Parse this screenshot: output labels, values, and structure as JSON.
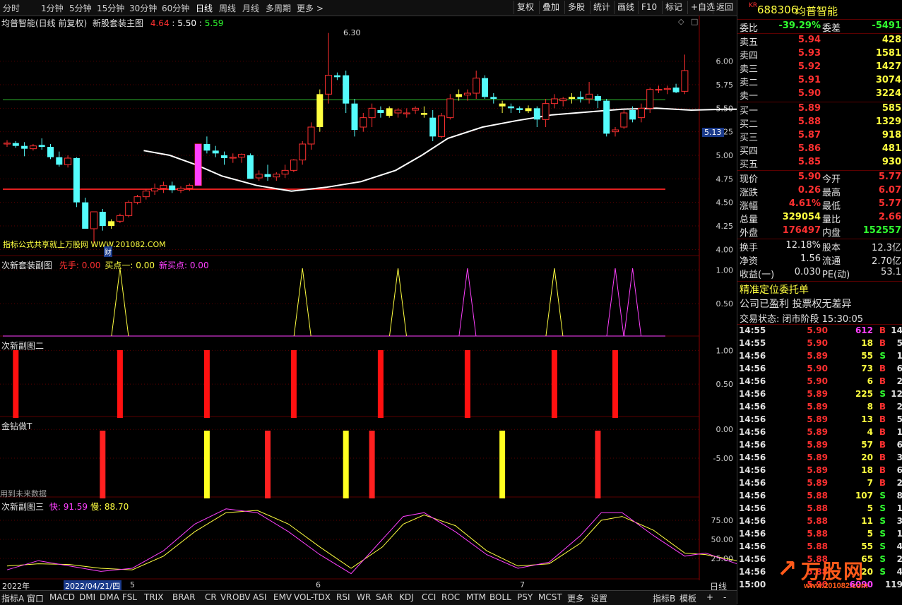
{
  "toolbar": {
    "periods": [
      "分时",
      "1分钟",
      "5分钟",
      "15分钟",
      "30分钟",
      "60分钟",
      "日线",
      "周线",
      "月线",
      "多周期",
      "更多 >"
    ],
    "active_period": "日线",
    "right_buttons": [
      "复权",
      "叠加",
      "多股",
      "统计",
      "画线",
      "F10",
      "标记",
      "+自选",
      "返回"
    ]
  },
  "main_panel": {
    "stock_label": "均普智能(日线 前复权)",
    "indicator_name": "新股套装主图",
    "values": [
      "4.64",
      "5.50",
      "5.59"
    ],
    "annotation": "指标公式共享就上万股网 WWW.201082.COM",
    "high_label": "6.30",
    "event_tag": "财",
    "current_price_tag": "5.13",
    "y_ticks": [
      "6.00",
      "5.75",
      "5.50",
      "5.25",
      "5.00",
      "4.75",
      "4.50",
      "4.25",
      "4.00"
    ]
  },
  "sub1": {
    "name": "次新套装副图",
    "labels": [
      {
        "text": "先手: 0.00",
        "color": "#ff3030"
      },
      {
        "text": "买点一: 0.00",
        "color": "#ffff40"
      },
      {
        "text": "新买点: 0.00",
        "color": "#ff40ff"
      }
    ],
    "y_ticks": [
      "1.00",
      "0.50"
    ]
  },
  "sub2": {
    "name": "次新副图二",
    "y_ticks": [
      "1.00",
      "0.50"
    ]
  },
  "sub3": {
    "name": "金钻做T",
    "note": "用到未来数据",
    "y_ticks": [
      "0.00",
      "-5.00"
    ]
  },
  "sub4": {
    "name": "次新副图三",
    "labels": [
      {
        "text": "快: 91.59",
        "color": "#ff40ff"
      },
      {
        "text": "慢: 88.70",
        "color": "#ffff40"
      }
    ],
    "y_ticks": [
      "75.00",
      "50.00",
      "25.00"
    ]
  },
  "date_axis": {
    "year": "2022年",
    "cursor_date": "2022/04/21/四",
    "months": [
      "5",
      "6",
      "7"
    ],
    "period": "日线"
  },
  "bottom_tabs": [
    "指标A",
    "窗口",
    "MACD",
    "DMI",
    "DMA",
    "FSL",
    "TRIX",
    "BRAR",
    "CR",
    "VR",
    "OBV",
    "ASI",
    "EMV",
    "VOL-TDX",
    "RSI",
    "WR",
    "SAR",
    "KDJ",
    "CCI",
    "ROC",
    "MTM",
    "BOLL",
    "PSY",
    "MCST",
    "更多",
    "设置"
  ],
  "bottom_right": [
    "指标B",
    "模板",
    "+",
    "-"
  ],
  "quote": {
    "badge": "KR",
    "code": "688306",
    "name": "均普智能",
    "weibi_label": "委比",
    "weibi": "-39.29%",
    "weicha_label": "委差",
    "weicha": "-5491",
    "asks": [
      {
        "label": "卖五",
        "price": "5.94",
        "vol": "428"
      },
      {
        "label": "卖四",
        "price": "5.93",
        "vol": "1581"
      },
      {
        "label": "卖三",
        "price": "5.92",
        "vol": "1427"
      },
      {
        "label": "卖二",
        "price": "5.91",
        "vol": "3074"
      },
      {
        "label": "卖一",
        "price": "5.90",
        "vol": "3224"
      }
    ],
    "bids": [
      {
        "label": "买一",
        "price": "5.89",
        "vol": "585"
      },
      {
        "label": "买二",
        "price": "5.88",
        "vol": "1329"
      },
      {
        "label": "买三",
        "price": "5.87",
        "vol": "918"
      },
      {
        "label": "买四",
        "price": "5.86",
        "vol": "481"
      },
      {
        "label": "买五",
        "price": "5.85",
        "vol": "930"
      }
    ],
    "stats": [
      {
        "l1": "现价",
        "v1": "5.90",
        "c1": "#ff3030",
        "l2": "今开",
        "v2": "5.77",
        "c2": "#ff3030"
      },
      {
        "l1": "涨跌",
        "v1": "0.26",
        "c1": "#ff3030",
        "l2": "最高",
        "v2": "6.07",
        "c2": "#ff3030"
      },
      {
        "l1": "涨幅",
        "v1": "4.61%",
        "c1": "#ff3030",
        "l2": "最低",
        "v2": "5.77",
        "c2": "#ff3030"
      },
      {
        "l1": "总量",
        "v1": "329054",
        "c1": "#ffff40",
        "l2": "量比",
        "v2": "2.66",
        "c2": "#ff3030"
      },
      {
        "l1": "外盘",
        "v1": "176497",
        "c1": "#ff3030",
        "l2": "内盘",
        "v2": "152557",
        "c2": "#30ff30"
      }
    ],
    "stats2": [
      {
        "l1": "换手",
        "v1": "12.18%",
        "l2": "股本",
        "v2": "12.3亿"
      },
      {
        "l1": "净资",
        "v1": "1.56",
        "l2": "流通",
        "v2": "2.70亿"
      },
      {
        "l1": "收益(一)",
        "v1": "0.030",
        "l2": "PE(动)",
        "v2": "53.1"
      }
    ],
    "link1": "精准定位委托单",
    "line2": "公司已盈利 投票权无差异",
    "status": "交易状态: 闭市阶段 15:30:05",
    "ticks": [
      {
        "t": "14:55",
        "p": "5.90",
        "v": "612",
        "s": "B",
        "n": "14",
        "vc": "#ff40ff"
      },
      {
        "t": "14:55",
        "p": "5.90",
        "v": "18",
        "s": "B",
        "n": "5",
        "vc": "#ffff40"
      },
      {
        "t": "14:56",
        "p": "5.89",
        "v": "55",
        "s": "S",
        "n": "1",
        "vc": "#ffff40"
      },
      {
        "t": "14:56",
        "p": "5.90",
        "v": "73",
        "s": "B",
        "n": "6",
        "vc": "#ffff40"
      },
      {
        "t": "14:56",
        "p": "5.90",
        "v": "6",
        "s": "B",
        "n": "2",
        "vc": "#ffff40"
      },
      {
        "t": "14:56",
        "p": "5.89",
        "v": "225",
        "s": "S",
        "n": "12",
        "vc": "#ffff40"
      },
      {
        "t": "14:56",
        "p": "5.89",
        "v": "8",
        "s": "B",
        "n": "2",
        "vc": "#ffff40"
      },
      {
        "t": "14:56",
        "p": "5.89",
        "v": "13",
        "s": "B",
        "n": "5",
        "vc": "#ffff40"
      },
      {
        "t": "14:56",
        "p": "5.89",
        "v": "4",
        "s": "B",
        "n": "1",
        "vc": "#ffff40"
      },
      {
        "t": "14:56",
        "p": "5.89",
        "v": "57",
        "s": "B",
        "n": "6",
        "vc": "#ffff40"
      },
      {
        "t": "14:56",
        "p": "5.89",
        "v": "20",
        "s": "B",
        "n": "3",
        "vc": "#ffff40"
      },
      {
        "t": "14:56",
        "p": "5.89",
        "v": "18",
        "s": "B",
        "n": "6",
        "vc": "#ffff40"
      },
      {
        "t": "14:56",
        "p": "5.89",
        "v": "7",
        "s": "B",
        "n": "2",
        "vc": "#ffff40"
      },
      {
        "t": "14:56",
        "p": "5.88",
        "v": "107",
        "s": "S",
        "n": "8",
        "vc": "#ffff40"
      },
      {
        "t": "14:56",
        "p": "5.88",
        "v": "5",
        "s": "S",
        "n": "1",
        "vc": "#ffff40"
      },
      {
        "t": "14:56",
        "p": "5.88",
        "v": "11",
        "s": "S",
        "n": "3",
        "vc": "#ffff40"
      },
      {
        "t": "14:56",
        "p": "5.88",
        "v": "5",
        "s": "S",
        "n": "1",
        "vc": "#ffff40"
      },
      {
        "t": "14:56",
        "p": "5.88",
        "v": "55",
        "s": "S",
        "n": "4",
        "vc": "#ffff40"
      },
      {
        "t": "14:56",
        "p": "5.88",
        "v": "65",
        "s": "S",
        "n": "2",
        "vc": "#ffff40"
      },
      {
        "t": "14:56",
        "p": "5.88",
        "v": "20",
        "s": "S",
        "n": "4",
        "vc": "#ffff40"
      },
      {
        "t": "15:00",
        "p": "5.90",
        "v": "6090",
        "s": "",
        "n": "119",
        "vc": "#ff40ff"
      }
    ]
  },
  "watermark": {
    "text": "万股网",
    "url": "www.201082.com"
  },
  "colors": {
    "up": "#ff3030",
    "down": "#54fcfc",
    "yellow": "#ffff40",
    "magenta": "#ff40ff",
    "green": "#30ff30",
    "ma": "#ffffff"
  },
  "chart_data": {
    "type": "candlestick",
    "ylim": [
      3.95,
      6.35
    ],
    "candles": [
      [
        5.12,
        5.16,
        5.09,
        5.13
      ],
      [
        5.13,
        5.15,
        5.08,
        5.1
      ],
      [
        5.1,
        5.14,
        4.99,
        5.07
      ],
      [
        5.07,
        5.12,
        5.05,
        5.1
      ],
      [
        5.11,
        5.18,
        5.06,
        5.09
      ],
      [
        5.09,
        5.12,
        4.96,
        4.98
      ],
      [
        4.98,
        5.04,
        4.88,
        4.9
      ],
      [
        4.9,
        5.0,
        4.87,
        4.97
      ],
      [
        4.97,
        4.98,
        4.45,
        4.5
      ],
      [
        4.5,
        4.55,
        4.22,
        4.22
      ],
      [
        4.22,
        4.4,
        4.05,
        4.4
      ],
      [
        4.4,
        4.43,
        4.2,
        4.25
      ],
      [
        4.25,
        4.32,
        4.22,
        4.3
      ],
      [
        4.3,
        4.38,
        4.28,
        4.36
      ],
      [
        4.36,
        4.52,
        4.34,
        4.5
      ],
      [
        4.5,
        4.58,
        4.48,
        4.56
      ],
      [
        4.56,
        4.64,
        4.53,
        4.62
      ],
      [
        4.62,
        4.7,
        4.58,
        4.65
      ],
      [
        4.65,
        4.72,
        4.6,
        4.68
      ],
      [
        4.68,
        4.72,
        4.6,
        4.63
      ],
      [
        4.63,
        4.67,
        4.6,
        4.65
      ],
      [
        4.65,
        4.7,
        4.62,
        4.68
      ],
      [
        4.68,
        5.06,
        4.68,
        5.12
      ],
      [
        5.12,
        5.2,
        5.02,
        5.05
      ],
      [
        5.05,
        5.1,
        4.98,
        5.02
      ],
      [
        5.0,
        5.04,
        4.9,
        4.97
      ],
      [
        4.97,
        5.02,
        4.92,
        4.98
      ],
      [
        4.98,
        5.02,
        4.92,
        5.01
      ],
      [
        5.0,
        5.02,
        4.75,
        4.75
      ],
      [
        4.76,
        4.84,
        4.73,
        4.8
      ],
      [
        4.8,
        4.9,
        4.73,
        4.77
      ],
      [
        4.77,
        4.82,
        4.73,
        4.8
      ],
      [
        4.8,
        4.9,
        4.76,
        4.84
      ],
      [
        4.84,
        4.96,
        4.82,
        4.95
      ],
      [
        4.95,
        5.15,
        4.9,
        5.12
      ],
      [
        5.12,
        5.35,
        5.06,
        5.3
      ],
      [
        5.3,
        5.7,
        5.25,
        5.65
      ],
      [
        5.65,
        6.3,
        5.55,
        5.85
      ],
      [
        5.85,
        5.88,
        5.8,
        5.83
      ],
      [
        5.85,
        5.9,
        5.45,
        5.55
      ],
      [
        5.55,
        5.6,
        5.2,
        5.27
      ],
      [
        5.3,
        5.45,
        5.25,
        5.4
      ],
      [
        5.4,
        5.55,
        5.3,
        5.5
      ],
      [
        5.48,
        5.52,
        5.4,
        5.45
      ],
      [
        5.5,
        5.52,
        5.4,
        5.42
      ],
      [
        5.45,
        5.5,
        5.4,
        5.48
      ],
      [
        5.44,
        5.5,
        5.4,
        5.45
      ],
      [
        5.48,
        5.52,
        5.44,
        5.5
      ],
      [
        5.45,
        5.52,
        5.4,
        5.43
      ],
      [
        5.4,
        5.48,
        5.15,
        5.2
      ],
      [
        5.2,
        5.45,
        5.18,
        5.42
      ],
      [
        5.4,
        5.65,
        5.38,
        5.6
      ],
      [
        5.62,
        5.7,
        5.58,
        5.65
      ],
      [
        5.64,
        5.7,
        5.58,
        5.66
      ],
      [
        5.66,
        5.9,
        5.6,
        5.82
      ],
      [
        5.82,
        5.85,
        5.6,
        5.62
      ],
      [
        5.62,
        5.66,
        5.55,
        5.6
      ],
      [
        5.55,
        5.58,
        5.45,
        5.52
      ],
      [
        5.52,
        5.55,
        5.45,
        5.5
      ],
      [
        5.5,
        5.52,
        5.45,
        5.48
      ],
      [
        5.5,
        5.53,
        5.45,
        5.47
      ],
      [
        5.5,
        5.52,
        5.3,
        5.38
      ],
      [
        5.38,
        5.6,
        5.3,
        5.55
      ],
      [
        5.55,
        5.65,
        5.5,
        5.6
      ],
      [
        5.58,
        5.62,
        5.52,
        5.6
      ],
      [
        5.6,
        5.66,
        5.55,
        5.62
      ],
      [
        5.62,
        5.68,
        5.56,
        5.6
      ],
      [
        5.6,
        5.78,
        5.55,
        5.65
      ],
      [
        5.63,
        5.65,
        5.5,
        5.58
      ],
      [
        5.58,
        5.6,
        5.2,
        5.23
      ],
      [
        5.25,
        5.3,
        5.2,
        5.27
      ],
      [
        5.3,
        5.48,
        5.28,
        5.45
      ],
      [
        5.48,
        5.52,
        5.35,
        5.38
      ],
      [
        5.4,
        5.55,
        5.35,
        5.5
      ],
      [
        5.5,
        5.72,
        5.45,
        5.7
      ],
      [
        5.7,
        5.74,
        5.66,
        5.7
      ],
      [
        5.7,
        5.74,
        5.65,
        5.71
      ],
      [
        5.72,
        5.76,
        5.66,
        5.67
      ],
      [
        5.68,
        6.07,
        5.65,
        5.9
      ]
    ],
    "yellow_candles": [
      12,
      36,
      44,
      48,
      52,
      57,
      60,
      65
    ],
    "ma": [
      [
        5,
        5.05
      ],
      [
        8,
        5.0
      ],
      [
        11,
        4.9
      ],
      [
        14,
        4.78
      ],
      [
        18,
        4.68
      ],
      [
        22,
        4.62
      ],
      [
        26,
        4.66
      ],
      [
        30,
        4.72
      ],
      [
        34,
        4.84
      ],
      [
        37,
        5.0
      ],
      [
        40,
        5.18
      ],
      [
        44,
        5.3
      ],
      [
        48,
        5.37
      ],
      [
        52,
        5.43
      ],
      [
        56,
        5.46
      ],
      [
        60,
        5.49
      ],
      [
        64,
        5.5
      ],
      [
        68,
        5.48
      ],
      [
        72,
        5.49
      ],
      [
        76,
        5.49
      ],
      [
        78,
        5.51
      ]
    ],
    "resistance": 5.59,
    "support": 4.64,
    "sub1_peaks": [
      {
        "x": 13,
        "c": "#ffff40"
      },
      {
        "x": 34,
        "c": "#ffff40"
      },
      {
        "x": 45,
        "c": "#ffff40"
      },
      {
        "x": 53,
        "c": "#ff40ff"
      },
      {
        "x": 63,
        "c": "#ffff40"
      },
      {
        "x": 70,
        "c": "#ff40ff"
      },
      {
        "x": 72,
        "c": "#ff40ff"
      }
    ],
    "sub2_bars": [
      1,
      13,
      23,
      33,
      43,
      53,
      63,
      70
    ],
    "sub3_bars": [
      {
        "x": 11,
        "c": "#ff2020"
      },
      {
        "x": 23,
        "c": "#ffff20"
      },
      {
        "x": 30,
        "c": "#ff2020"
      },
      {
        "x": 39,
        "c": "#ffff20"
      },
      {
        "x": 42,
        "c": "#ff2020"
      },
      {
        "x": 57,
        "c": "#ffff20"
      },
      {
        "x": 68,
        "c": "#ff2020"
      }
    ],
    "fast": [
      [
        0,
        10
      ],
      [
        3,
        22
      ],
      [
        6,
        15
      ],
      [
        9,
        8
      ],
      [
        12,
        12
      ],
      [
        15,
        35
      ],
      [
        18,
        70
      ],
      [
        21,
        90
      ],
      [
        24,
        85
      ],
      [
        27,
        60
      ],
      [
        30,
        30
      ],
      [
        33,
        5
      ],
      [
        36,
        50
      ],
      [
        38,
        80
      ],
      [
        40,
        85
      ],
      [
        43,
        60
      ],
      [
        46,
        30
      ],
      [
        49,
        12
      ],
      [
        52,
        20
      ],
      [
        55,
        55
      ],
      [
        57,
        85
      ],
      [
        59,
        85
      ],
      [
        62,
        55
      ],
      [
        65,
        28
      ],
      [
        67,
        32
      ],
      [
        70,
        18
      ],
      [
        72,
        30
      ],
      [
        75,
        85
      ],
      [
        78,
        92
      ]
    ],
    "slow": [
      [
        0,
        15
      ],
      [
        3,
        18
      ],
      [
        6,
        17
      ],
      [
        9,
        12
      ],
      [
        12,
        10
      ],
      [
        15,
        28
      ],
      [
        18,
        60
      ],
      [
        21,
        85
      ],
      [
        24,
        88
      ],
      [
        27,
        70
      ],
      [
        30,
        40
      ],
      [
        33,
        12
      ],
      [
        36,
        40
      ],
      [
        38,
        70
      ],
      [
        40,
        82
      ],
      [
        43,
        68
      ],
      [
        46,
        35
      ],
      [
        49,
        15
      ],
      [
        52,
        18
      ],
      [
        55,
        45
      ],
      [
        57,
        75
      ],
      [
        59,
        80
      ],
      [
        62,
        62
      ],
      [
        65,
        32
      ],
      [
        67,
        30
      ],
      [
        70,
        22
      ],
      [
        72,
        25
      ],
      [
        75,
        72
      ],
      [
        78,
        89
      ]
    ]
  }
}
